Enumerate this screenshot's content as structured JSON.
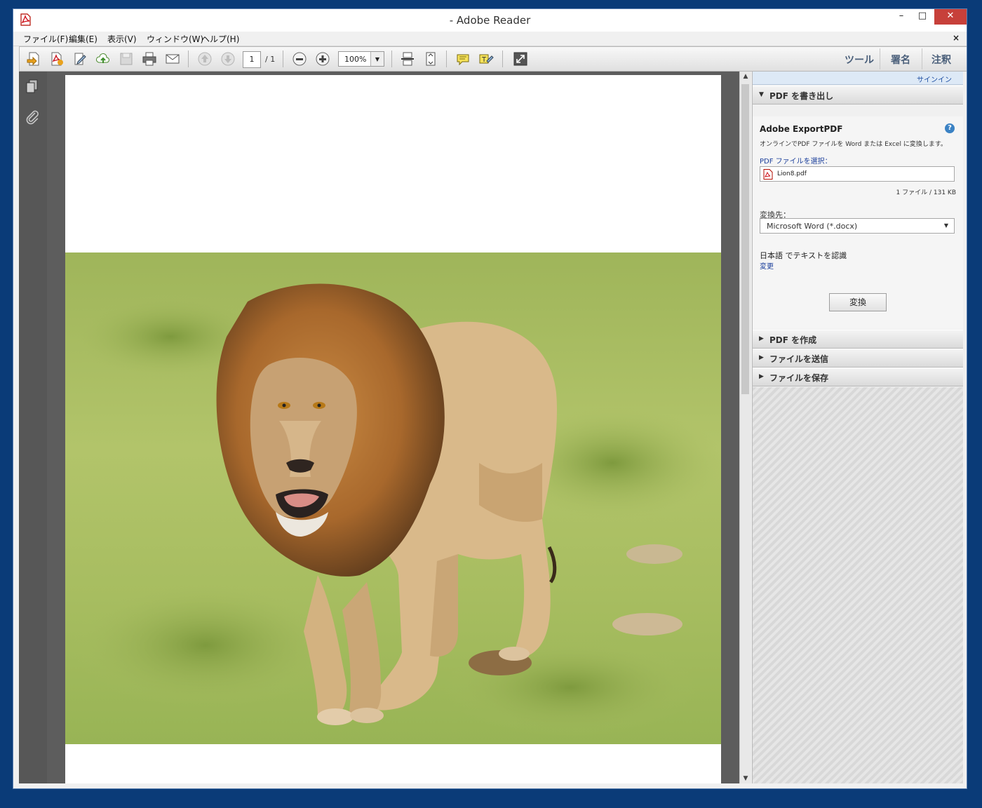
{
  "window": {
    "title": "- Adobe Reader",
    "minimize_label": "–",
    "maximize_label": "□",
    "close_label": "✕"
  },
  "menu": {
    "items": [
      "ファイル(F)",
      "編集(E)",
      "表示(V)",
      "ウィンドウ(W)",
      "ヘルプ(H)"
    ],
    "close_label": "×"
  },
  "toolbar": {
    "page_number": "1",
    "page_total": "/ 1",
    "zoom": "100%",
    "tabs": [
      "ツール",
      "署名",
      "注釈"
    ]
  },
  "document": {
    "image": "lion photograph on grassland"
  },
  "panel": {
    "signin": "サインイン",
    "export_section": {
      "label": "PDF を書き出し",
      "service_title": "Adobe ExportPDF",
      "description": "オンラインでPDF ファイルを Word または Excel に変換します。",
      "select_label": "PDF ファイルを選択：",
      "file_name": "Lion8.pdf",
      "file_info": "1 ファイル / 131 KB",
      "convert_to_label": "変換先：",
      "format": "Microsoft Word (*.docx)",
      "ocr_text": "日本語 でテキストを認識",
      "ocr_change": "変更",
      "convert_button": "変換"
    },
    "other_sections": [
      "PDF を作成",
      "ファイルを送信",
      "ファイルを保存"
    ]
  },
  "colors": {
    "desktop": "#0a3b78",
    "close_button": "#c7403a",
    "link": "#1b3f9b",
    "tab_text": "#4a5f7a"
  }
}
